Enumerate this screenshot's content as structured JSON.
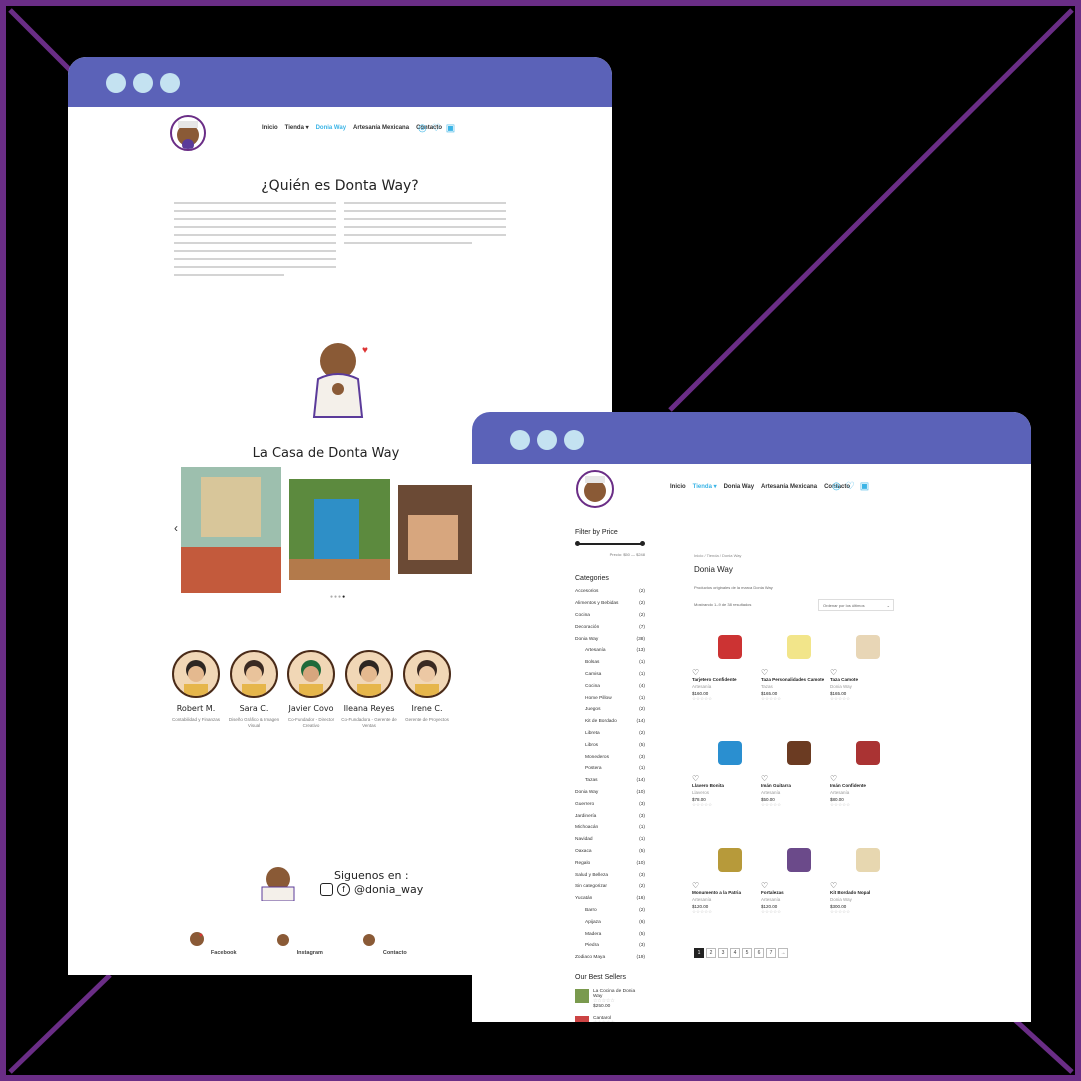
{
  "colors": {
    "frame": "#6a2d86",
    "titlebar": "#5b62b8",
    "dots": "#c4e2f1",
    "accent": "#3bb4e6"
  },
  "left": {
    "nav": {
      "items": [
        "Inicio",
        "Tienda ▾",
        "Donia Way",
        "Artesanía Mexicana",
        "Contacto"
      ],
      "active": 2,
      "icons": [
        "user-icon",
        "heart-icon",
        "cart-icon"
      ]
    },
    "title": "¿Quién es Donta Way?",
    "casa_title": "La Casa de Donta Way",
    "carousel_arrow": "‹",
    "team": [
      {
        "name": "Robert M.",
        "role": "Contabilidad y Finanzas"
      },
      {
        "name": "Sara C.",
        "role": "Diseño Gráfico & Imagen Visual"
      },
      {
        "name": "Javier Covo",
        "role": "Co-Fundador - Director Creativo"
      },
      {
        "name": "Ileana Reyes",
        "role": "Co-Fundadora - Gerente de Ventas"
      },
      {
        "name": "Irene C.",
        "role": "Gerente de Proyectos"
      }
    ],
    "follow": {
      "label": "Siguenos en :",
      "handle": "@donia_way"
    },
    "footer": [
      {
        "label": "Facebook"
      },
      {
        "label": "Instagram"
      },
      {
        "label": "Contacto"
      }
    ]
  },
  "right": {
    "nav": {
      "items": [
        "Inicio",
        "Tienda ▾",
        "Donia Way",
        "Artesanía Mexicana",
        "Contacto"
      ],
      "active": 1
    },
    "filter": {
      "title": "Filter by Price",
      "range": "Precio: $50 — $248"
    },
    "categories_title": "Categories",
    "categories": [
      {
        "n": "Accesorios",
        "c": "(2)",
        "sub": false
      },
      {
        "n": "Alimentos y Bebidas",
        "c": "(2)",
        "sub": false
      },
      {
        "n": "Cocina",
        "c": "(2)",
        "sub": false
      },
      {
        "n": "Decoración",
        "c": "(7)",
        "sub": false
      },
      {
        "n": "Donia Way",
        "c": "(38)",
        "sub": false
      },
      {
        "n": "Artesanía",
        "c": "(13)",
        "sub": true
      },
      {
        "n": "Bolsas",
        "c": "(1)",
        "sub": true
      },
      {
        "n": "Camisa",
        "c": "(1)",
        "sub": true
      },
      {
        "n": "Cocina",
        "c": "(4)",
        "sub": true
      },
      {
        "n": "Home Pillow",
        "c": "(1)",
        "sub": true
      },
      {
        "n": "Juegos",
        "c": "(2)",
        "sub": true
      },
      {
        "n": "Kit de Bordado",
        "c": "(14)",
        "sub": true
      },
      {
        "n": "Libreta",
        "c": "(2)",
        "sub": true
      },
      {
        "n": "Libros",
        "c": "(5)",
        "sub": true
      },
      {
        "n": "Monederos",
        "c": "(3)",
        "sub": true
      },
      {
        "n": "Postera",
        "c": "(1)",
        "sub": true
      },
      {
        "n": "Tazas",
        "c": "(14)",
        "sub": true
      },
      {
        "n": "Donia Way",
        "c": "(10)",
        "sub": false
      },
      {
        "n": "Guerrero",
        "c": "(3)",
        "sub": false
      },
      {
        "n": "Jardinería",
        "c": "(3)",
        "sub": false
      },
      {
        "n": "Michoacán",
        "c": "(1)",
        "sub": false
      },
      {
        "n": "Navidad",
        "c": "(1)",
        "sub": false
      },
      {
        "n": "Oaxaca",
        "c": "(5)",
        "sub": false
      },
      {
        "n": "Regalo",
        "c": "(10)",
        "sub": false
      },
      {
        "n": "Salud y Belleza",
        "c": "(3)",
        "sub": false
      },
      {
        "n": "Sin categorizar",
        "c": "(2)",
        "sub": false
      },
      {
        "n": "Yucatán",
        "c": "(16)",
        "sub": false
      },
      {
        "n": "Barro",
        "c": "(2)",
        "sub": true
      },
      {
        "n": "Apijaza",
        "c": "(6)",
        "sub": true
      },
      {
        "n": "Madera",
        "c": "(5)",
        "sub": true
      },
      {
        "n": "Piedra",
        "c": "(3)",
        "sub": true
      },
      {
        "n": "Zodiaco Maya",
        "c": "(19)",
        "sub": false
      }
    ],
    "best_title": "Our Best Sellers",
    "best": [
      {
        "name": "La Cocina de Donia Way",
        "price": "$250.00"
      },
      {
        "name": "Cantarol",
        "price": ""
      }
    ],
    "breadcrumb": "Inicio / Tienda / Donia Way",
    "shop_title": "Donia Way",
    "desc": "Productos originales de la marca Donia Way",
    "showing": "Mostrando 1–9 de 38 resultados",
    "sort": "Ordenar por los últimos",
    "products": [
      {
        "name": "Tarjetero Confidente",
        "cat": "Artesanía",
        "price": "$160.00"
      },
      {
        "name": "Taza Personalidades Camote",
        "cat": "Tazas",
        "price": "$165.00"
      },
      {
        "name": "Taza Camote",
        "cat": "Donia Way",
        "price": "$165.00"
      },
      {
        "name": "Llavero Bonita",
        "cat": "Llaveros",
        "price": "$78.00"
      },
      {
        "name": "Imán Guitarra",
        "cat": "Artesanía",
        "price": "$50.00"
      },
      {
        "name": "Imán Confidente",
        "cat": "Artesanía",
        "price": "$80.00"
      },
      {
        "name": "Monumento a la Patria",
        "cat": "Artesanía",
        "price": "$120.00"
      },
      {
        "name": "Fortalezas",
        "cat": "Artesanía",
        "price": "$120.00"
      },
      {
        "name": "Kit Bordado Nopal",
        "cat": "Donia Way",
        "price": "$300.00"
      }
    ],
    "stars": "☆☆☆☆☆",
    "pages": [
      "1",
      "2",
      "3",
      "4",
      "5",
      "6",
      "7",
      "→"
    ]
  }
}
